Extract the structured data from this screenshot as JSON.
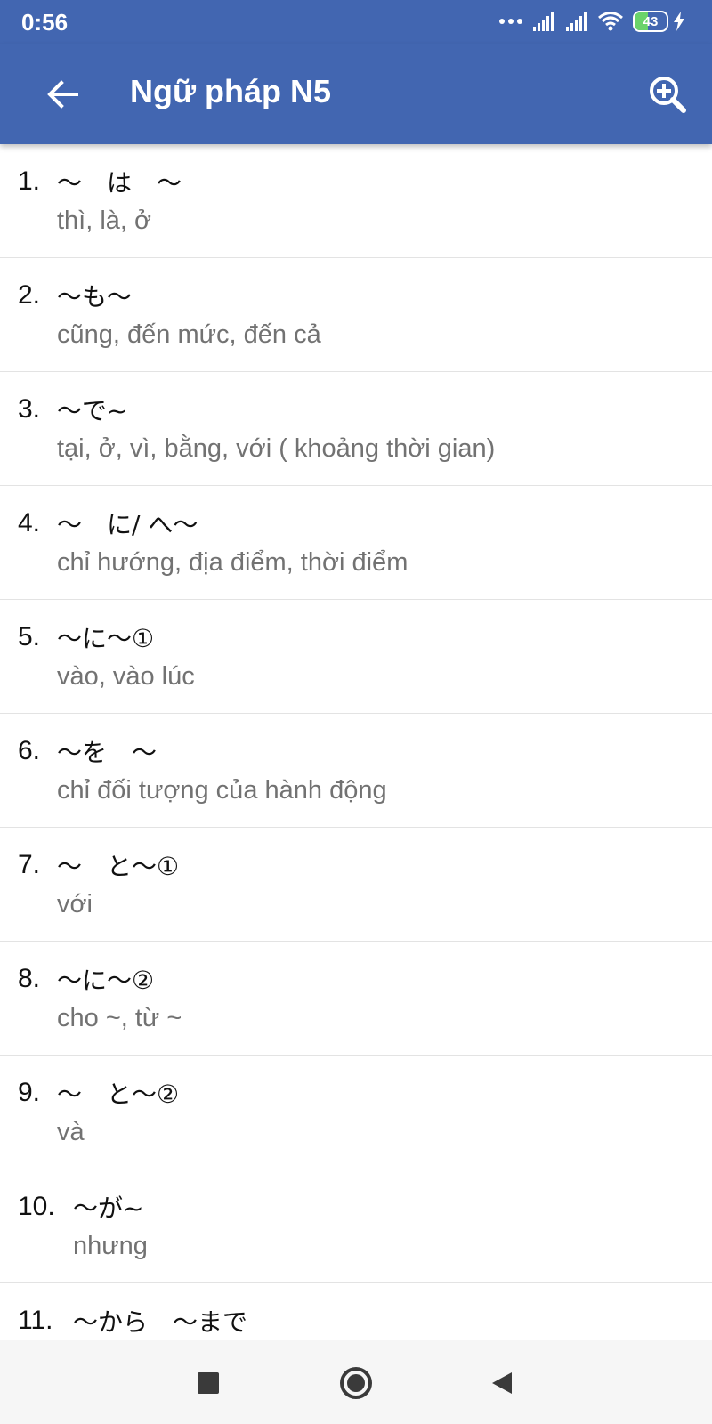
{
  "status_bar": {
    "time": "0:56",
    "battery": "43"
  },
  "app_bar": {
    "title": "Ngữ pháp N5",
    "back_icon": "arrow-left-icon",
    "zoom_icon": "zoom-in-icon"
  },
  "colors": {
    "primary": "#4266b1",
    "meaning_text": "#727272",
    "divider": "#e3e3e3"
  },
  "grammar_list": [
    {
      "number": "1.",
      "pattern": "～　は　～",
      "meaning": "thì, là, ở"
    },
    {
      "number": "2.",
      "pattern": "〜も〜",
      "meaning": "cũng, đến mức, đến cả"
    },
    {
      "number": "3.",
      "pattern": "～で~",
      "meaning": "tại, ở, vì, bằng, với ( khoảng thời gian)"
    },
    {
      "number": "4.",
      "pattern": "～　に/ へ～",
      "meaning": "chỉ hướng, địa điểm, thời điểm"
    },
    {
      "number": "5.",
      "pattern": "～に～①",
      "meaning": "vào, vào lúc"
    },
    {
      "number": "6.",
      "pattern": "～を　～",
      "meaning": "chỉ đối tượng của hành động"
    },
    {
      "number": "7.",
      "pattern": "～　と～①",
      "meaning": "với"
    },
    {
      "number": "8.",
      "pattern": "～に～②",
      "meaning": "cho ~, từ ~"
    },
    {
      "number": "9.",
      "pattern": "～　と～②",
      "meaning": "và"
    },
    {
      "number": "10.",
      "pattern": "～が~",
      "meaning": "nhưng"
    },
    {
      "number": "11.",
      "pattern": "～から　～まで",
      "meaning": ""
    }
  ],
  "nav_bar": {
    "recents_icon": "square-icon",
    "home_icon": "circle-icon",
    "back_icon": "triangle-back-icon"
  }
}
